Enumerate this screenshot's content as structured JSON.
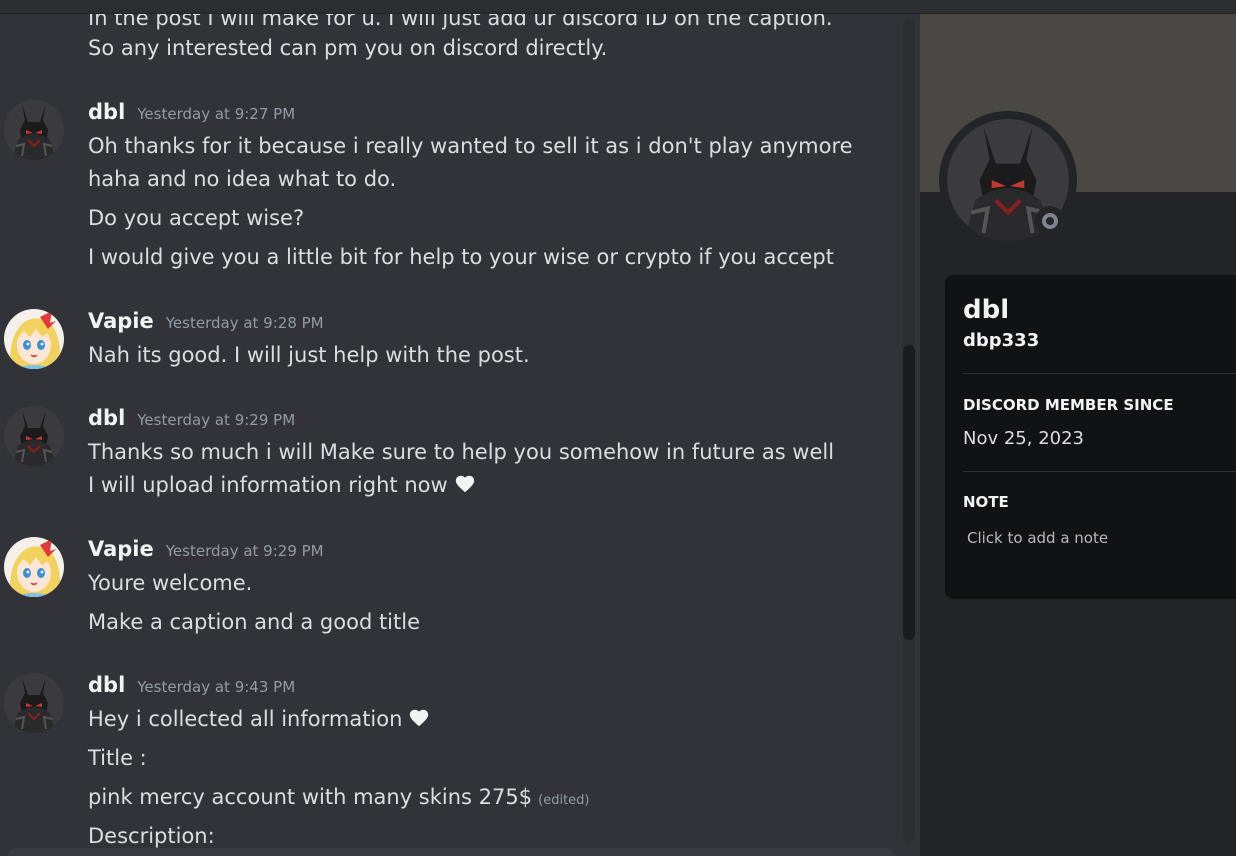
{
  "chat": {
    "top_lines": [
      "In the post I will make for u. I will just add ur discord ID on the caption.",
      "So any interested can pm you on discord directly."
    ],
    "messages": [
      {
        "author": "dbl",
        "timestamp": "Yesterday at 9:27 PM",
        "lines": [
          "Oh thanks for it because i really wanted to sell it as i don't play anymore",
          "haha and no idea what to do.",
          "Do you accept wise?",
          "I would give you a little bit for help to your wise or crypto if you accept"
        ]
      },
      {
        "author": "Vapie",
        "timestamp": "Yesterday at 9:28 PM",
        "lines": [
          "Nah its good. I will just help with the post."
        ]
      },
      {
        "author": "dbl",
        "timestamp": "Yesterday at 9:29 PM",
        "lines": [
          "Thanks so much i will Make sure to help you somehow in future as well",
          "I will upload information right now"
        ]
      },
      {
        "author": "Vapie",
        "timestamp": "Yesterday at 9:29 PM",
        "lines": [
          "Youre welcome.",
          "Make a caption and a good title"
        ]
      },
      {
        "author": "dbl",
        "timestamp": "Yesterday at 9:43 PM",
        "lines": [
          "Hey i collected all information",
          "Title :",
          "pink mercy account with many skins 275$",
          "Description:"
        ],
        "edited_label": "(edited)"
      }
    ]
  },
  "profile": {
    "display_name": "dbl",
    "username": "dbp333",
    "member_since_label": "DISCORD MEMBER SINCE",
    "member_since": "Nov 25, 2023",
    "note_label": "NOTE",
    "note_placeholder": "Click to add a note",
    "status": "offline"
  },
  "colors": {
    "chat_bg": "#313338",
    "panel_bg": "#232428",
    "card_bg": "#111214",
    "banner": "#4a4844",
    "text": "#dbdee1",
    "muted": "#949ba4"
  },
  "icons": {
    "heart": "white-heart-icon",
    "status": "offline-status-icon"
  }
}
